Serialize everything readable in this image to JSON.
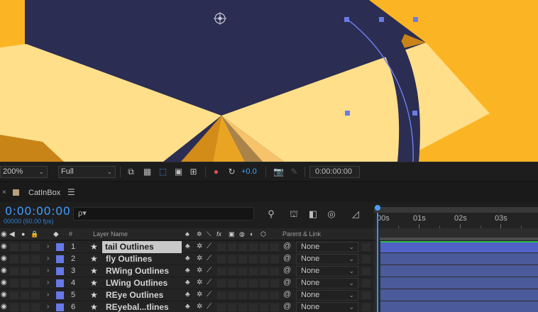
{
  "viewer": {
    "colors": {
      "background": "#fbb524",
      "box_dark": "#2b2d52",
      "box_flap": "#ffdf8a",
      "box_shadow": "#c98418",
      "path": "#6a7be6"
    }
  },
  "toolbar": {
    "zoom": "200%",
    "resolution": "Full",
    "exposure": "+0.0",
    "time": "0:00:00:00"
  },
  "timeline_tab": {
    "close": "×",
    "comp_name": "CatInBox",
    "menu": "☰"
  },
  "timeline": {
    "timecode": "0:00:00:00",
    "fps": "00000 (60.00 fps)",
    "search_placeholder": "ρ▾",
    "ruler": {
      "labels": [
        "00s",
        "01s",
        "02s",
        "03s"
      ]
    },
    "columns": {
      "num": "#",
      "layer_name": "Layer Name",
      "parent_link": "Parent & Link"
    }
  },
  "layers": [
    {
      "num": "1",
      "name": "tail Outlines",
      "parent": "None",
      "selected": true
    },
    {
      "num": "2",
      "name": "fly Outlines",
      "parent": "None"
    },
    {
      "num": "3",
      "name": "RWing Outlines",
      "parent": "None"
    },
    {
      "num": "4",
      "name": "LWing Outlines",
      "parent": "None"
    },
    {
      "num": "5",
      "name": "REye Outlines",
      "parent": "None"
    },
    {
      "num": "6",
      "name": "REyebal...tlines",
      "parent": "None"
    }
  ]
}
